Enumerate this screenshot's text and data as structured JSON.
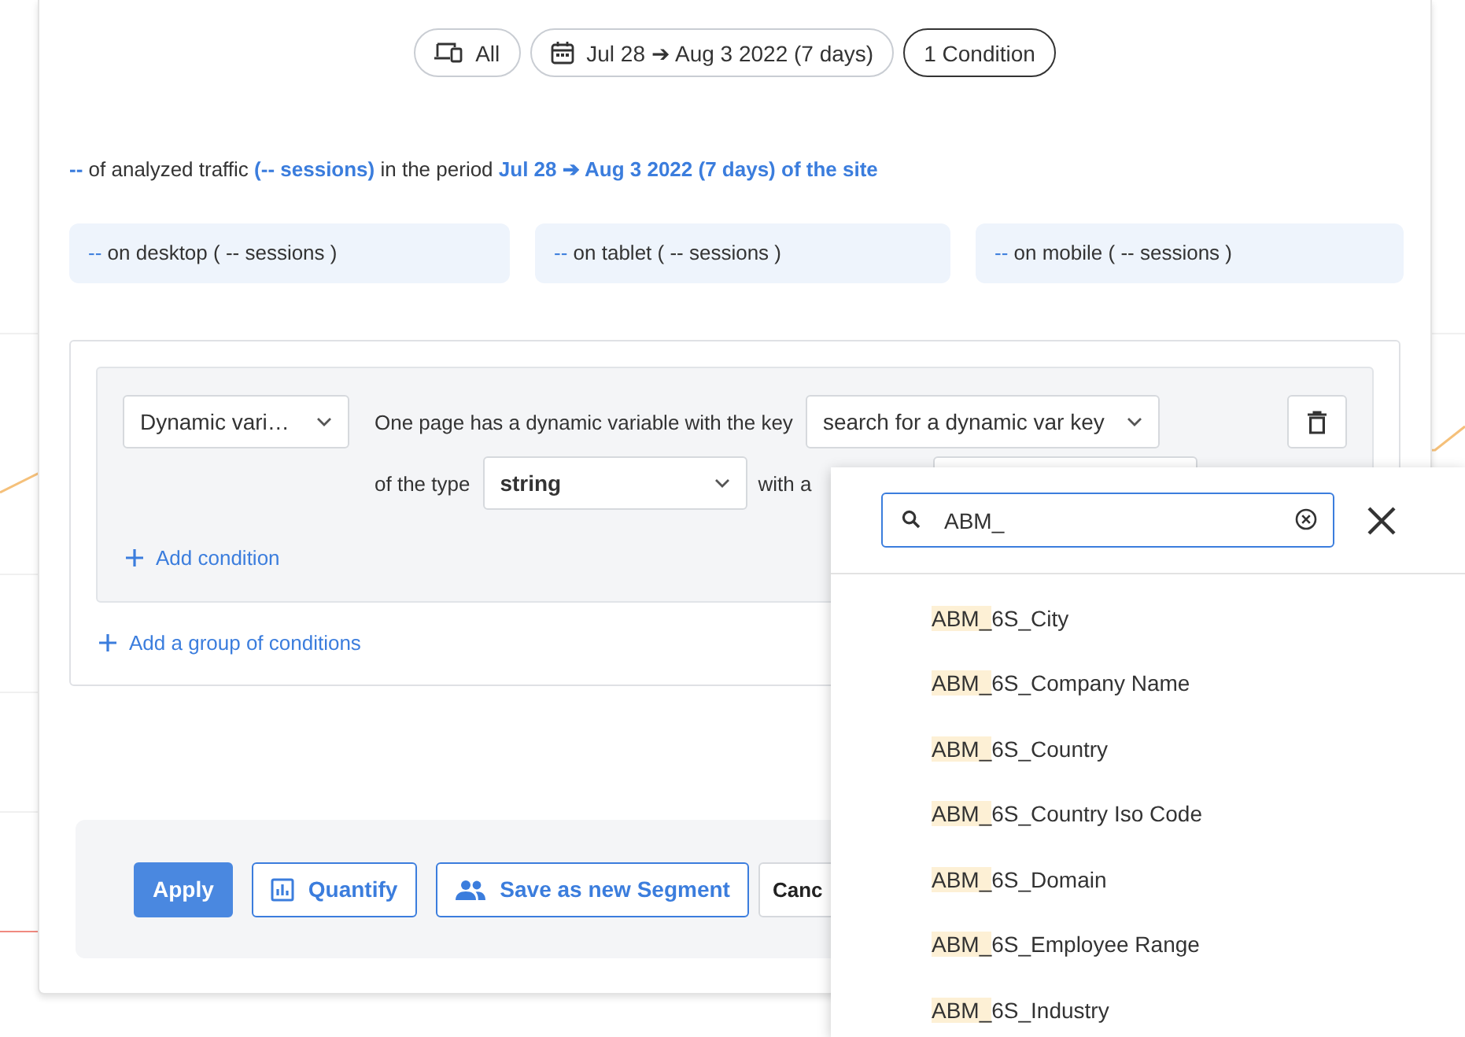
{
  "filters": [
    {
      "kind": "devices",
      "label": "All",
      "selected": false
    },
    {
      "kind": "date",
      "label": "Jul 28 ➔ Aug 3 2022 (7 days)",
      "selected": false
    },
    {
      "kind": "plain",
      "label": "1 Condition",
      "selected": true
    }
  ],
  "summary": "**--** of analyzed traffic **(-- sessions)** in the period **Jul 28 ➔ Aug 3 2022 (7 days) of the site**",
  "device_cards": [
    "**--** on desktop ( -- sessions )",
    "**--** on tablet ( -- sessions )",
    "**--** on mobile ( -- sessions )"
  ],
  "condition": {
    "field_select": "Dynamic vari…",
    "key_text": "One page has a dynamic variable with the key",
    "key_select": "search for a dynamic var key",
    "type_text": "of the type",
    "type_select": "string",
    "value_text": "with a",
    "add_condition": "Add condition"
  },
  "add_group": "Add a group of conditions",
  "actions": [
    {
      "kind": "primary",
      "label": "Apply"
    },
    {
      "kind": "quantify",
      "label": "Quantify"
    },
    {
      "kind": "segment",
      "label": "Save as new Segment"
    },
    {
      "kind": "plain",
      "label": "Canc"
    }
  ],
  "key_dropdown": {
    "search_value": "ABM_",
    "items": [
      {
        "match": "ABM_",
        "rest": "6S_City"
      },
      {
        "match": "ABM_",
        "rest": "6S_Company Name"
      },
      {
        "match": "ABM_",
        "rest": "6S_Country"
      },
      {
        "match": "ABM_",
        "rest": "6S_Country Iso Code"
      },
      {
        "match": "ABM_",
        "rest": "6S_Domain"
      },
      {
        "match": "ABM_",
        "rest": "6S_Employee Range"
      },
      {
        "match": "ABM_",
        "rest": "6S_Industry"
      }
    ]
  }
}
